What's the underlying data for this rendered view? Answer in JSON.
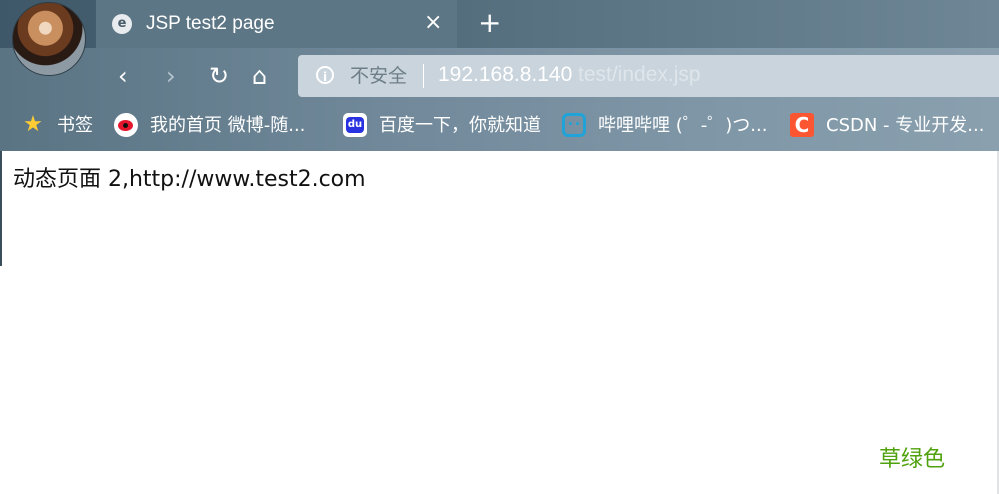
{
  "browser": {
    "tab": {
      "title": "JSP test2 page"
    },
    "address": {
      "security_label": "不安全",
      "host": "192.168.8.140",
      "path": "test/index.jsp"
    },
    "bookmarks": [
      {
        "label": "书签",
        "icon": "star-icon"
      },
      {
        "label": "我的首页 微博-随...",
        "icon": "weibo-icon"
      },
      {
        "label": "百度一下，你就知道",
        "icon": "baidu-icon"
      },
      {
        "label": "哔哩哔哩 (゜-゜)つ...",
        "icon": "bilibili-icon"
      },
      {
        "label": "CSDN - 专业开发...",
        "icon": "csdn-icon"
      }
    ]
  },
  "page": {
    "content": "动态页面 2,http://www.test2.com",
    "corner_label": "草绿色",
    "corner_label_color": "#4fa20d"
  }
}
